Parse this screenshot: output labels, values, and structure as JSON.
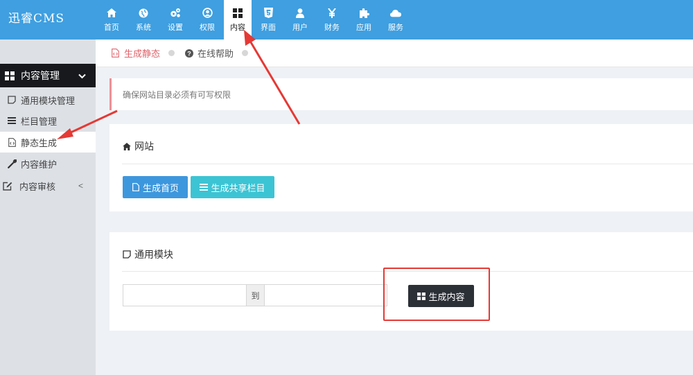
{
  "app": {
    "logo": "迅睿CMS"
  },
  "topnav": {
    "items": [
      {
        "label": "首页",
        "icon": "home-icon"
      },
      {
        "label": "系统",
        "icon": "globe-icon"
      },
      {
        "label": "设置",
        "icon": "gears-icon"
      },
      {
        "label": "权限",
        "icon": "user-circle-icon"
      },
      {
        "label": "内容",
        "icon": "grid-icon",
        "active": true
      },
      {
        "label": "界面",
        "icon": "html5-icon"
      },
      {
        "label": "用户",
        "icon": "user-icon"
      },
      {
        "label": "财务",
        "icon": "yen-icon"
      },
      {
        "label": "应用",
        "icon": "puzzle-icon"
      },
      {
        "label": "服务",
        "icon": "cloud-icon"
      }
    ]
  },
  "sidebar": {
    "header": "内容管理",
    "items": [
      {
        "label": "通用模块管理",
        "icon": "square-icon"
      },
      {
        "label": "栏目管理",
        "icon": "list-icon"
      },
      {
        "label": "静态生成",
        "icon": "file-code-icon",
        "active": true
      },
      {
        "label": "内容维护",
        "icon": "wrench-icon"
      },
      {
        "label": "内容审核",
        "icon": "edit-icon",
        "arrow": "<"
      }
    ]
  },
  "tabs": [
    {
      "label": "生成静态",
      "icon": "file-code-icon",
      "active": true
    },
    {
      "label": "在线帮助",
      "icon": "question-circle-icon"
    }
  ],
  "alert": {
    "text": "确保网站目录必须有可写权限"
  },
  "panel_site": {
    "title": "网站",
    "btn_home": "生成首页",
    "btn_shared": "生成共享栏目"
  },
  "panel_module": {
    "title": "通用模块",
    "from_value": "",
    "range_sep": "到",
    "to_value": "",
    "btn_generate": "生成内容"
  },
  "colors": {
    "topbar": "#3f9fe0",
    "accent_red": "#e53935",
    "sidebar_head": "#17191c"
  }
}
